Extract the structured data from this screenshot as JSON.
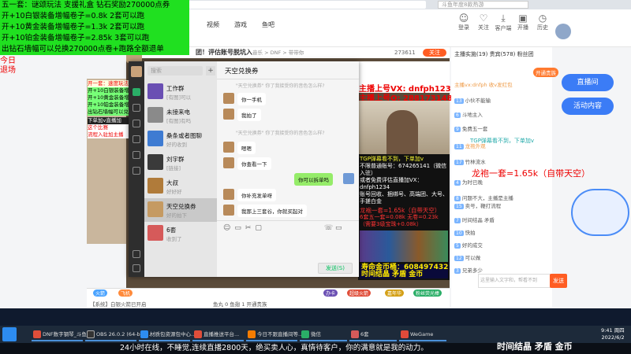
{
  "browser": {
    "address": "s/76694",
    "site_search_placeholder": "斗鱼年度8款热游",
    "nav": [
      "视频",
      "游戏",
      "鱼吧"
    ],
    "header_icons": [
      {
        "label": "登录",
        "icon": "user-icon"
      },
      {
        "label": "关注",
        "icon": "heart-icon"
      },
      {
        "label": "客户端",
        "icon": "download-icon"
      },
      {
        "label": "开播",
        "icon": "camera-icon"
      },
      {
        "label": "历史",
        "icon": "clock-icon"
      },
      {
        "label": "消息",
        "icon": "bell-icon"
      }
    ]
  },
  "overlay_green": {
    "lines": [
      "五一套：谜颂玩法 支援礼盒 钻石奖励270000点券",
      "开+10白银装备增幅卷子=0.8k    2套可以跑",
      "开+10黄金装备增幅卷子=1.3k    2套可以跑",
      "开+10铂金装备增幅卷子=2.85k  3套可以跑",
      "出钻石墙幅可以兑换270000点卷+跑路全额退单"
    ]
  },
  "overlay_red_left": [
    "今日",
    "退场"
  ],
  "stream": {
    "title": "团！评估账号脱坑入",
    "breadcrumb": "音乐 > DNF > 带带你",
    "viewers": "273611",
    "follow_label": "关注",
    "anchor_vx": "主播上号VX: dnfph123",
    "anchor_qq": "主播上号Q: 2881731488",
    "tgp_note": "TGP弹幕看不到，下单加v",
    "dragon_line": "龙袍一套=1.65k（自带天空）",
    "promo_lines": [
      "龙袍一套=1.65k（自带天空）",
      "6套五一套=0.08k 无卷=0.23k",
      "（需要3级宝珠+0.08k）"
    ],
    "info_lines": [
      "TGP弹幕看不到，下单加v",
      "不限普通账号：674265141（微信入驻）",
      "或者免费评估直播加VX：dnfph1234",
      "账号回收、捆绑号、高端团、大号、手搓白金"
    ],
    "gold_label": "寿命金币桶：608497432",
    "bottom_yellow": "时间结晶 矛盾 金币",
    "overlay_small": [
      "开一套：速度玩法",
      "开+10白银装备增幅",
      "开+10黄金装备增幅",
      "开+10铂金装备增幅",
      "出钻石墙幅可以兑换",
      "时间结晶 矛盾 金币"
    ],
    "left_red_mini": [
      "下单加v直播加",
      "这个比赛",
      "流程入驻加主播"
    ],
    "level_line": "开黑粉丝：276（0%）"
  },
  "wechat": {
    "search_placeholder": "搜索",
    "contacts": [
      {
        "name": "工作群",
        "sub": "[有图]可以",
        "color": "#6a4fb3"
      },
      {
        "name": "未接来电",
        "sub": "[有图]有吗",
        "color": "#8a8a8a"
      },
      {
        "name": "桑条或者图聊",
        "sub": "好的收到",
        "color": "#3e7bd2"
      },
      {
        "name": "刘宇群",
        "sub": "[链接]",
        "color": "#3a3a3a"
      },
      {
        "name": "大叔",
        "sub": "好好好",
        "color": "#b07b3a"
      },
      {
        "name": "天空兑换券",
        "sub": "好的拍下",
        "color": "#c59a62"
      },
      {
        "name": "6套",
        "sub": "收到了",
        "color": "#d65a5a"
      }
    ],
    "chat_title": "天空兑换券",
    "messages": [
      {
        "side": "sys",
        "text": "\"天空兑换券\" 你了我接受你的音色怎么样?"
      },
      {
        "side": "them",
        "text": "你一手机"
      },
      {
        "side": "them",
        "text": "我拍了"
      },
      {
        "side": "sys",
        "text": "\"天空兑换券\" 你了我接受你的音色怎么样?"
      },
      {
        "side": "them",
        "text": "嗯嗯"
      },
      {
        "side": "them",
        "text": "你查看一下"
      },
      {
        "side": "me",
        "text": "你可以拆单吗"
      },
      {
        "side": "them",
        "text": "你补充发单呀"
      },
      {
        "side": "them",
        "text": "我那上三套谷，你就买起对"
      }
    ],
    "send_label": "发送(S)"
  },
  "right_chat": {
    "tabs": [
      "主播实施",
      "贵宾",
      "粉丝团"
    ],
    "tab_counts": "主播实施(19) 贵宾(578) 粉丝团",
    "btn_open": "开通贵族",
    "rows": [
      "主播vx:dnfph 收v发红包",
      "小伙不能输",
      "斗地主入",
      "免费五一套",
      "龙袍外观",
      "竹林流水",
      "为时已晚",
      "问题不大，主播是主播",
      "卖号，鞭打流程",
      "时间结晶 矛盾",
      "快拍",
      "好的成交",
      "可以做",
      "兄弟多少"
    ],
    "input_placeholder": "这里输入文字和，帮看不到",
    "send_label": "发送"
  },
  "side_buttons": [
    {
      "label": "直播间",
      "color": "#3b7cf6"
    },
    {
      "label": "活动内容",
      "color": "#3b7cf6"
    }
  ],
  "streambar": {
    "gifts": [
      "火箭",
      "飞机",
      "办卡",
      "超级火箭",
      "嘉年华",
      "粉丝荧光棒"
    ],
    "status": "【系统】白银火箭已开启",
    "balance": "鱼丸 0  鱼翅 1 开通贵族"
  },
  "taskbar": {
    "items": [
      {
        "label": "DNF数字钢琴_斗鱼...",
        "color": "#e04e3a"
      },
      {
        "label": "OBS 26.0.2 (64-bit)...",
        "color": "#333"
      },
      {
        "label": "材质包资源包中心...",
        "color": "#2d8cf0"
      },
      {
        "label": "直播推送平台...",
        "color": "#e04e3a"
      },
      {
        "label": "今日不跟直播间等...",
        "color": "#f57c00"
      },
      {
        "label": "微信",
        "color": "#2aae67"
      },
      {
        "label": "6套",
        "color": "#d65a5a"
      },
      {
        "label": "WeGame",
        "color": "#e14a3a"
      }
    ],
    "time": "9:41 周四",
    "date": "2022/6/2"
  },
  "subtitle": "24小时在线，不睡觉,连续直播2800天，绝买卖人心，真情待客户，你的满意就是我的动力。",
  "ticker": "时间结晶 矛盾 金币"
}
